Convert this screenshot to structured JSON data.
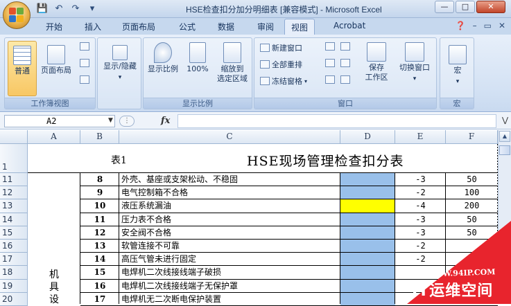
{
  "window": {
    "title": "HSE检查扣分加分明细表  [兼容模式] - Microsoft Excel",
    "buttons": [
      "minimize",
      "maximize",
      "close"
    ]
  },
  "qat": {
    "icons": [
      "save-icon",
      "undo-icon",
      "redo-icon",
      "customize-icon"
    ]
  },
  "tabs": [
    "开始",
    "插入",
    "页面布局",
    "公式",
    "数据",
    "审阅",
    "视图",
    "Acrobat"
  ],
  "active_tab": "视图",
  "ribbon": {
    "workbook_views": {
      "label": "工作簿视图",
      "normal": "普通",
      "page_layout": "页面布局"
    },
    "show_hide": {
      "label": "显示/隐藏"
    },
    "zoom": {
      "label": "显示比例",
      "zoom": "显示比例",
      "hundred": "100%",
      "zoom_to_selection_line1": "缩放到",
      "zoom_to_selection_line2": "选定区域"
    },
    "window": {
      "label": "窗口",
      "new_window": "新建窗口",
      "arrange_all": "全部重排",
      "freeze_panes": "冻结窗格",
      "save_workspace_line1": "保存",
      "save_workspace_line2": "工作区",
      "switch_windows": "切换窗口"
    },
    "macros": {
      "label": "宏",
      "macro": "宏"
    }
  },
  "formula_bar": {
    "cell_ref": "A2",
    "fx": "fx",
    "formula": ""
  },
  "columns": [
    "A",
    "B",
    "C",
    "D",
    "E",
    "F"
  ],
  "sheet": {
    "title_left": "表1",
    "title_main": "HSE现场管理检查扣分表",
    "row1_number": "1",
    "category_chars": [
      "机",
      "具",
      "设"
    ],
    "rows": [
      {
        "row": "11",
        "no": "8",
        "item": "外壳、基座或支架松动、不稳固",
        "deduct": "-3",
        "amount": "50",
        "highlight": "blue"
      },
      {
        "row": "12",
        "no": "9",
        "item": "电气控制箱不合格",
        "deduct": "-2",
        "amount": "100",
        "highlight": "blue"
      },
      {
        "row": "13",
        "no": "10",
        "item": "液压系统漏油",
        "deduct": "-4",
        "amount": "200",
        "highlight": "yellow"
      },
      {
        "row": "14",
        "no": "11",
        "item": "压力表不合格",
        "deduct": "-3",
        "amount": "50",
        "highlight": "blue"
      },
      {
        "row": "15",
        "no": "12",
        "item": "安全阀不合格",
        "deduct": "-3",
        "amount": "50",
        "highlight": "blue"
      },
      {
        "row": "16",
        "no": "13",
        "item": "软管连接不可靠",
        "deduct": "-2",
        "amount": "",
        "highlight": "blue"
      },
      {
        "row": "17",
        "no": "14",
        "item": "高压气管未进行固定",
        "deduct": "-2",
        "amount": "",
        "highlight": "blue"
      },
      {
        "row": "18",
        "no": "15",
        "item": "电焊机二次线接线端子破损",
        "deduct": "",
        "amount": "",
        "highlight": "blue"
      },
      {
        "row": "19",
        "no": "16",
        "item": "电焊机二次线接线端子无保护罩",
        "deduct": "",
        "amount": "",
        "highlight": "blue"
      },
      {
        "row": "20",
        "no": "17",
        "item": "电焊机无二次断电保护装置",
        "deduct": "",
        "amount": "",
        "highlight": "blue"
      }
    ]
  },
  "colors": {
    "blue_cell": "#99c0ea",
    "yellow_cell": "#ffff00",
    "ribbon_accent": "#f8c764"
  },
  "watermark": {
    "url": "WWW.94IP.COM",
    "brand": "IT运维空间"
  }
}
